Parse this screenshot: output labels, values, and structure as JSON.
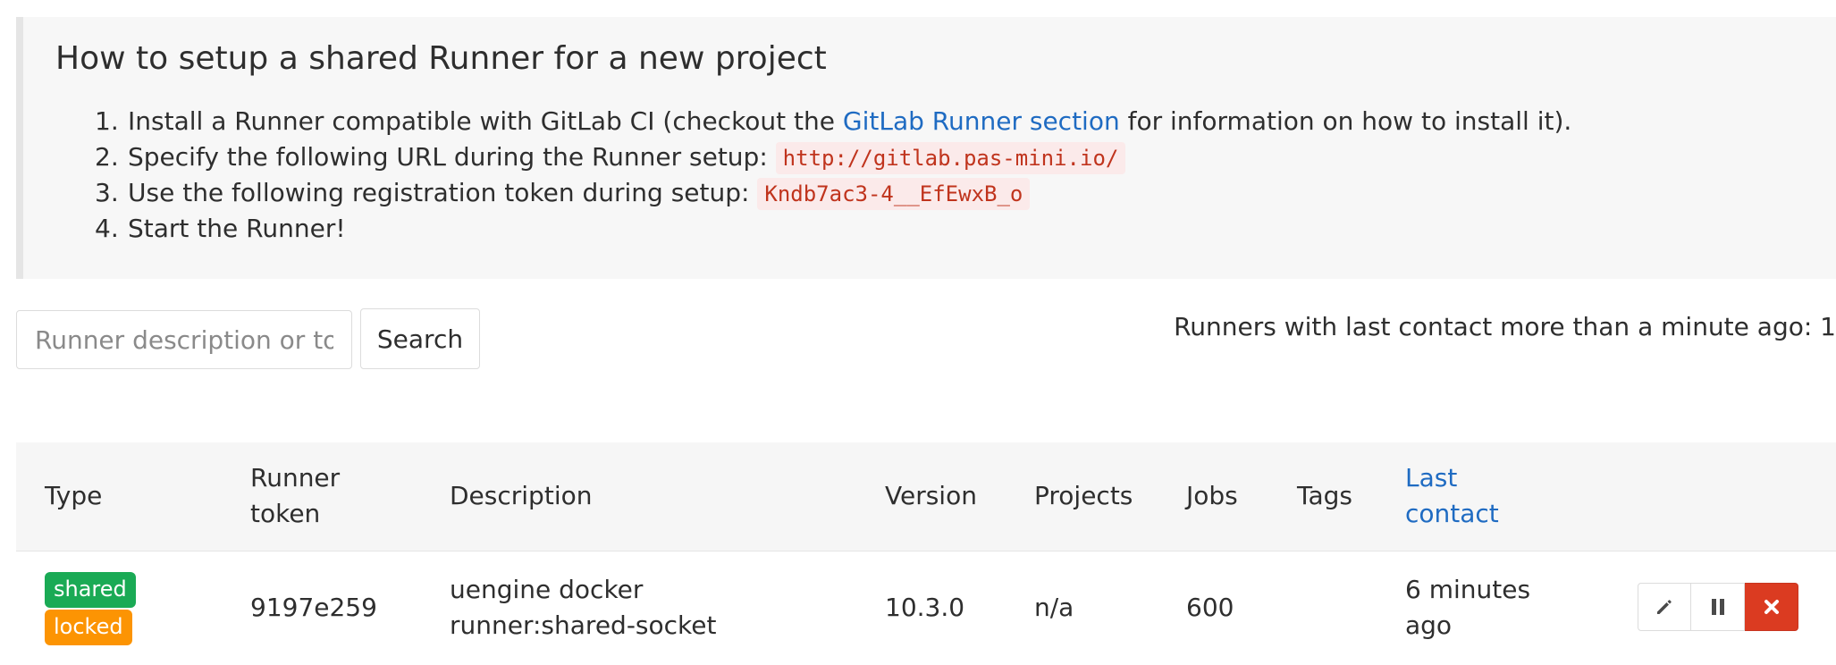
{
  "info": {
    "title": "How to setup a shared Runner for a new project",
    "steps": [
      {
        "num": "1.",
        "pre": "Install a Runner compatible with GitLab CI (checkout the ",
        "link": "GitLab Runner section",
        "post": " for information on how to install it)."
      },
      {
        "num": "2.",
        "pre": "Specify the following URL during the Runner setup: ",
        "code": "http://gitlab.pas-mini.io/"
      },
      {
        "num": "3.",
        "pre": "Use the following registration token during setup: ",
        "code": "Kndb7ac3-4__EfEwxB_o"
      },
      {
        "num": "4.",
        "pre": "Start the Runner!"
      }
    ]
  },
  "search": {
    "placeholder": "Runner description or token",
    "button_label": "Search"
  },
  "contact_note": "Runners with last contact more than a minute ago: 1",
  "table": {
    "headers": {
      "type": "Type",
      "token_line1": "Runner",
      "token_line2": "token",
      "description": "Description",
      "version": "Version",
      "projects": "Projects",
      "jobs": "Jobs",
      "tags": "Tags",
      "last_contact_line1": "Last",
      "last_contact_line2": "contact"
    },
    "rows": [
      {
        "badges": [
          "shared",
          "locked"
        ],
        "token": "9197e259",
        "description_line1": "uengine docker",
        "description_line2": "runner:shared-socket",
        "version": "10.3.0",
        "projects": "n/a",
        "jobs": "600",
        "tags": "",
        "last_contact_line1": "6 minutes",
        "last_contact_line2": "ago"
      }
    ]
  },
  "icons": {
    "edit": "pencil-icon",
    "pause": "pause-icon",
    "remove": "close-icon"
  },
  "colors": {
    "link": "#1f6bc2",
    "shared_badge": "#1aaa55",
    "locked_badge": "#fc9403",
    "danger": "#db3b21",
    "code_text": "#c0341d"
  }
}
